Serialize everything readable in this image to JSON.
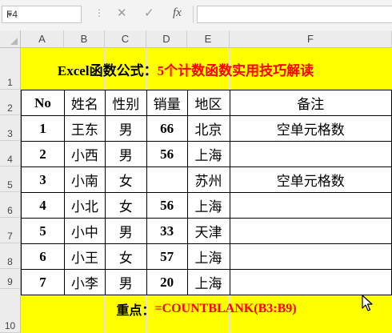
{
  "formula_bar": {
    "name_box": "F4",
    "fx_label": "fx",
    "formula": ""
  },
  "columns": [
    "A",
    "B",
    "C",
    "D",
    "E",
    "F"
  ],
  "rows": [
    "1",
    "2",
    "3",
    "4",
    "5",
    "6",
    "7",
    "8",
    "9",
    "10"
  ],
  "title": {
    "part1": "Excel函数公式：",
    "part2": "5个计数函数实用技巧解读"
  },
  "table": {
    "headers": [
      "No",
      "姓名",
      "性别",
      "销量",
      "地区",
      "备注"
    ],
    "rows": [
      [
        "1",
        "王东",
        "男",
        "66",
        "北京",
        "空单元格数"
      ],
      [
        "2",
        "小西",
        "男",
        "56",
        "上海",
        ""
      ],
      [
        "3",
        "小南",
        "女",
        "",
        "苏州",
        "空单元格数"
      ],
      [
        "4",
        "小北",
        "女",
        "56",
        "上海",
        ""
      ],
      [
        "5",
        "小中",
        "男",
        "33",
        "天津",
        ""
      ],
      [
        "6",
        "小王",
        "女",
        "57",
        "上海",
        ""
      ],
      [
        "7",
        "小李",
        "男",
        "20",
        "上海",
        ""
      ]
    ]
  },
  "key_point": {
    "label": "重点：",
    "formula": "=COUNTBLANK(B3:B9)"
  },
  "colors": {
    "banner": "#ffff00",
    "accent_red": "#ff0000"
  }
}
